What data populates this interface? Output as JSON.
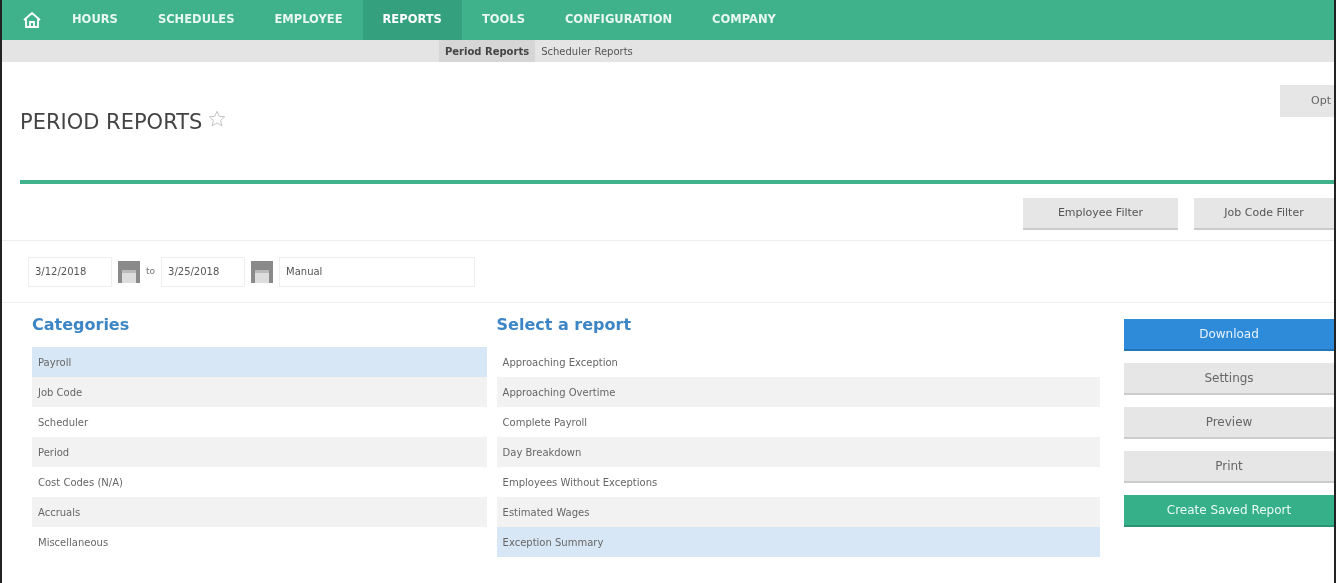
{
  "nav": {
    "items": [
      {
        "label": "HOURS",
        "selected": false
      },
      {
        "label": "SCHEDULES",
        "selected": false
      },
      {
        "label": "EMPLOYEE",
        "selected": false
      },
      {
        "label": "REPORTS",
        "selected": true
      },
      {
        "label": "TOOLS",
        "selected": false
      },
      {
        "label": "CONFIGURATION",
        "selected": false
      },
      {
        "label": "COMPANY",
        "selected": false
      }
    ]
  },
  "subnav": {
    "items": [
      {
        "label": "Period Reports",
        "selected": true
      },
      {
        "label": "Scheduler Reports",
        "selected": false
      }
    ]
  },
  "page": {
    "title": "PERIOD REPORTS",
    "favorite": false,
    "options_button": "Opt"
  },
  "filters": [
    "Employee Filter",
    "Job Code Filter"
  ],
  "date_range": {
    "from": "3/12/2018",
    "separator": "to",
    "to": "3/25/2018",
    "period": "Manual"
  },
  "categories": {
    "heading": "Categories",
    "items": [
      {
        "label": "Payroll",
        "selected": true
      },
      {
        "label": "Job Code",
        "selected": false
      },
      {
        "label": "Scheduler",
        "selected": false
      },
      {
        "label": "Period",
        "selected": false
      },
      {
        "label": "Cost Codes (N/A)",
        "selected": false
      },
      {
        "label": "Accruals",
        "selected": false
      },
      {
        "label": "Miscellaneous",
        "selected": false
      }
    ]
  },
  "reports": {
    "heading": "Select a report",
    "items": [
      {
        "label": "Approaching Exception",
        "selected": false
      },
      {
        "label": "Approaching Overtime",
        "selected": false
      },
      {
        "label": "Complete Payroll",
        "selected": false
      },
      {
        "label": "Day Breakdown",
        "selected": false
      },
      {
        "label": "Employees Without Exceptions",
        "selected": false
      },
      {
        "label": "Estimated Wages",
        "selected": false
      },
      {
        "label": "Exception Summary",
        "selected": true
      }
    ]
  },
  "actions": [
    {
      "label": "Download",
      "kind": "primary"
    },
    {
      "label": "Settings",
      "kind": "secondary"
    },
    {
      "label": "Preview",
      "kind": "secondary"
    },
    {
      "label": "Print",
      "kind": "secondary"
    },
    {
      "label": "Create Saved Report",
      "kind": "success"
    }
  ]
}
